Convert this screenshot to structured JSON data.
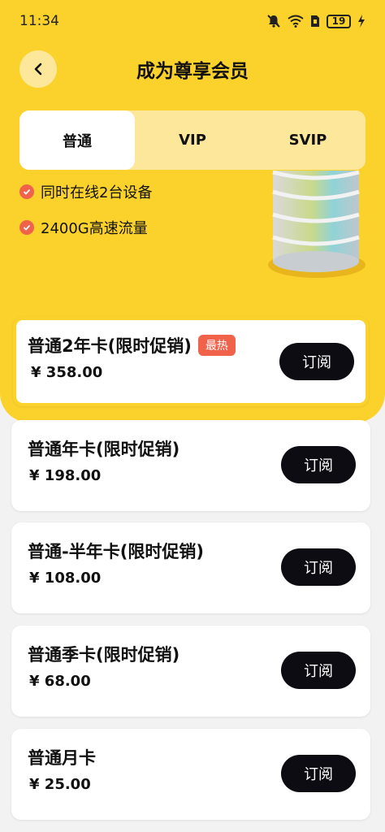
{
  "status_bar": {
    "time": "11:34",
    "battery": "19"
  },
  "header": {
    "title": "成为尊享会员"
  },
  "tabs": [
    {
      "label": "普通",
      "active": true
    },
    {
      "label": "VIP",
      "active": false
    },
    {
      "label": "SVIP",
      "active": false
    }
  ],
  "features": [
    {
      "text": "同时在线2台设备"
    },
    {
      "text": "2400G高速流量"
    }
  ],
  "plans": [
    {
      "name": "普通2年卡(限时促销)",
      "price": "¥ 358.00",
      "badge": "最热",
      "button": "订阅",
      "featured": true
    },
    {
      "name": "普通年卡(限时促销)",
      "price": "¥ 198.00",
      "button": "订阅"
    },
    {
      "name": "普通-半年卡(限时促销)",
      "price": "¥ 108.00",
      "button": "订阅"
    },
    {
      "name": "普通季卡(限时促销)",
      "price": "¥ 68.00",
      "button": "订阅"
    },
    {
      "name": "普通月卡",
      "price": "¥ 25.00",
      "button": "订阅"
    }
  ],
  "colors": {
    "accent_yellow": "#fbd12c",
    "badge_red": "#f0624a",
    "button_dark": "#0c0c12"
  },
  "icons": [
    "mute-bell-icon",
    "wifi-icon",
    "sim-icon",
    "battery-icon",
    "charging-icon",
    "back-arrow-icon",
    "check-icon",
    "server-illustration"
  ]
}
